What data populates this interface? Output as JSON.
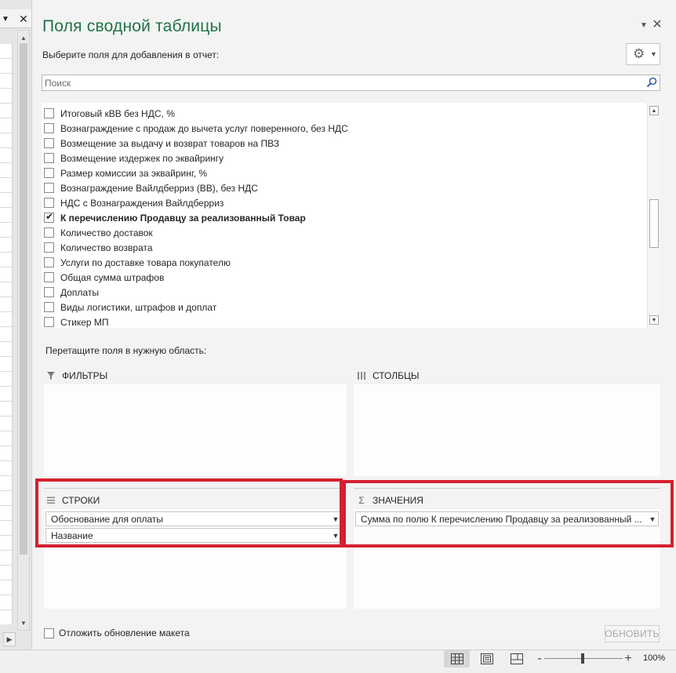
{
  "pane": {
    "title": "Поля сводной таблицы",
    "subtitle": "Выберите поля для добавления в отчет:",
    "search_placeholder": "Поиск",
    "menu_icon": "chevron-down-icon",
    "close_icon": "close-icon",
    "settings_icon": "gear-icon"
  },
  "fields": [
    {
      "label": "Итоговый кВВ без НДС, %",
      "checked": false
    },
    {
      "label": "Вознаграждение с продаж до вычета услуг поверенного, без НДС",
      "checked": false
    },
    {
      "label": "Возмещение за выдачу и возврат товаров на ПВЗ",
      "checked": false
    },
    {
      "label": "Возмещение издержек по эквайрингу",
      "checked": false
    },
    {
      "label": "Размер комиссии за эквайринг, %",
      "checked": false
    },
    {
      "label": "Вознаграждение Вайлдберриз (ВВ), без НДС",
      "checked": false
    },
    {
      "label": "НДС с Вознаграждения Вайлдберриз",
      "checked": false
    },
    {
      "label": "К перечислению Продавцу за реализованный Товар",
      "checked": true
    },
    {
      "label": "Количество доставок",
      "checked": false
    },
    {
      "label": "Количество возврата",
      "checked": false
    },
    {
      "label": "Услуги по доставке товара покупателю",
      "checked": false
    },
    {
      "label": "Общая сумма штрафов",
      "checked": false
    },
    {
      "label": "Доплаты",
      "checked": false
    },
    {
      "label": "Виды логистики, штрафов и доплат",
      "checked": false
    },
    {
      "label": "Стикер МП",
      "checked": false
    }
  ],
  "areas": {
    "drag_hint": "Перетащите поля в нужную область:",
    "filters": {
      "label": "ФИЛЬТРЫ",
      "icon": "filter-icon"
    },
    "columns": {
      "label": "СТОЛБЦЫ",
      "icon": "columns-icon"
    },
    "rows": {
      "label": "СТРОКИ",
      "icon": "rows-icon",
      "items": [
        "Обоснование для оплаты",
        "Название"
      ]
    },
    "values": {
      "label": "ЗНАЧЕНИЯ",
      "icon": "sigma-icon",
      "items": [
        "Сумма по полю К перечислению Продавцу за реализованный ..."
      ]
    }
  },
  "footer": {
    "defer_label": "Отложить обновление макета",
    "defer_checked": false,
    "update_label": "ОБНОВИТЬ"
  },
  "statusbar": {
    "zoom_level": "100%",
    "zoom_minus": "-",
    "zoom_plus": "+",
    "zoom_fraction": 0.5
  },
  "highlight_color": "#d42030",
  "accent_color": "#217346"
}
